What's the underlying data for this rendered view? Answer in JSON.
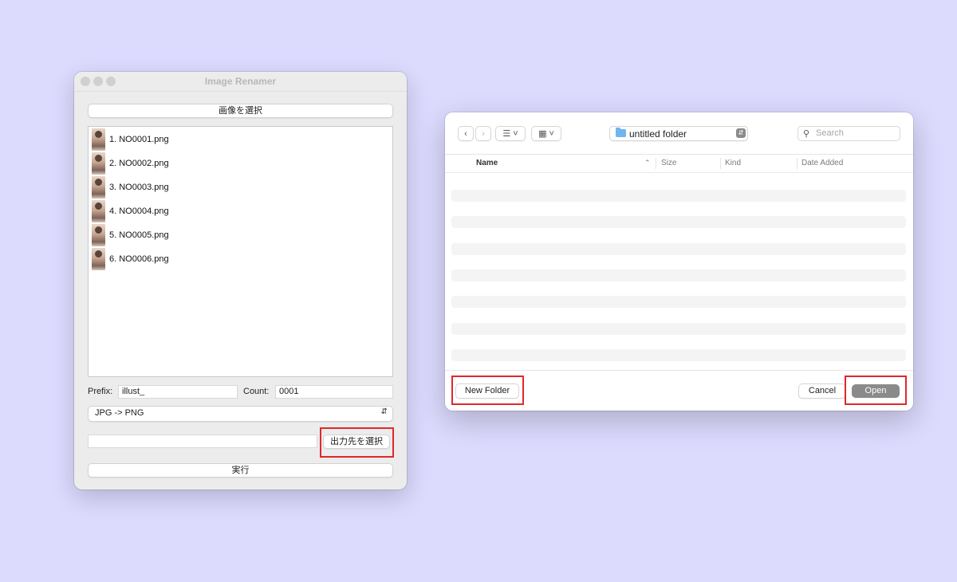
{
  "app_window": {
    "title": "Image Renamer",
    "select_images_label": "画像を選択",
    "files": [
      "1. NO0001.png",
      "2. NO0002.png",
      "3. NO0003.png",
      "4. NO0004.png",
      "5. NO0005.png",
      "6. NO0006.png"
    ],
    "prefix_label": "Prefix:",
    "prefix_value": "illust_",
    "count_label": "Count:",
    "count_value": "0001",
    "conversion_selected": "JPG -> PNG",
    "output_path_value": "",
    "select_output_label": "出力先を選択",
    "run_label": "実行"
  },
  "open_dialog": {
    "current_folder": "untitled folder",
    "search_placeholder": "Search",
    "columns": [
      "Name",
      "Size",
      "Kind",
      "Date Added"
    ],
    "new_folder_label": "New Folder",
    "cancel_label": "Cancel",
    "open_label": "Open"
  },
  "colors": {
    "background": "#dcdafd",
    "highlight": "#e0282c",
    "open_button": "#8a8a8a",
    "folder_icon": "#6fb5ef"
  }
}
